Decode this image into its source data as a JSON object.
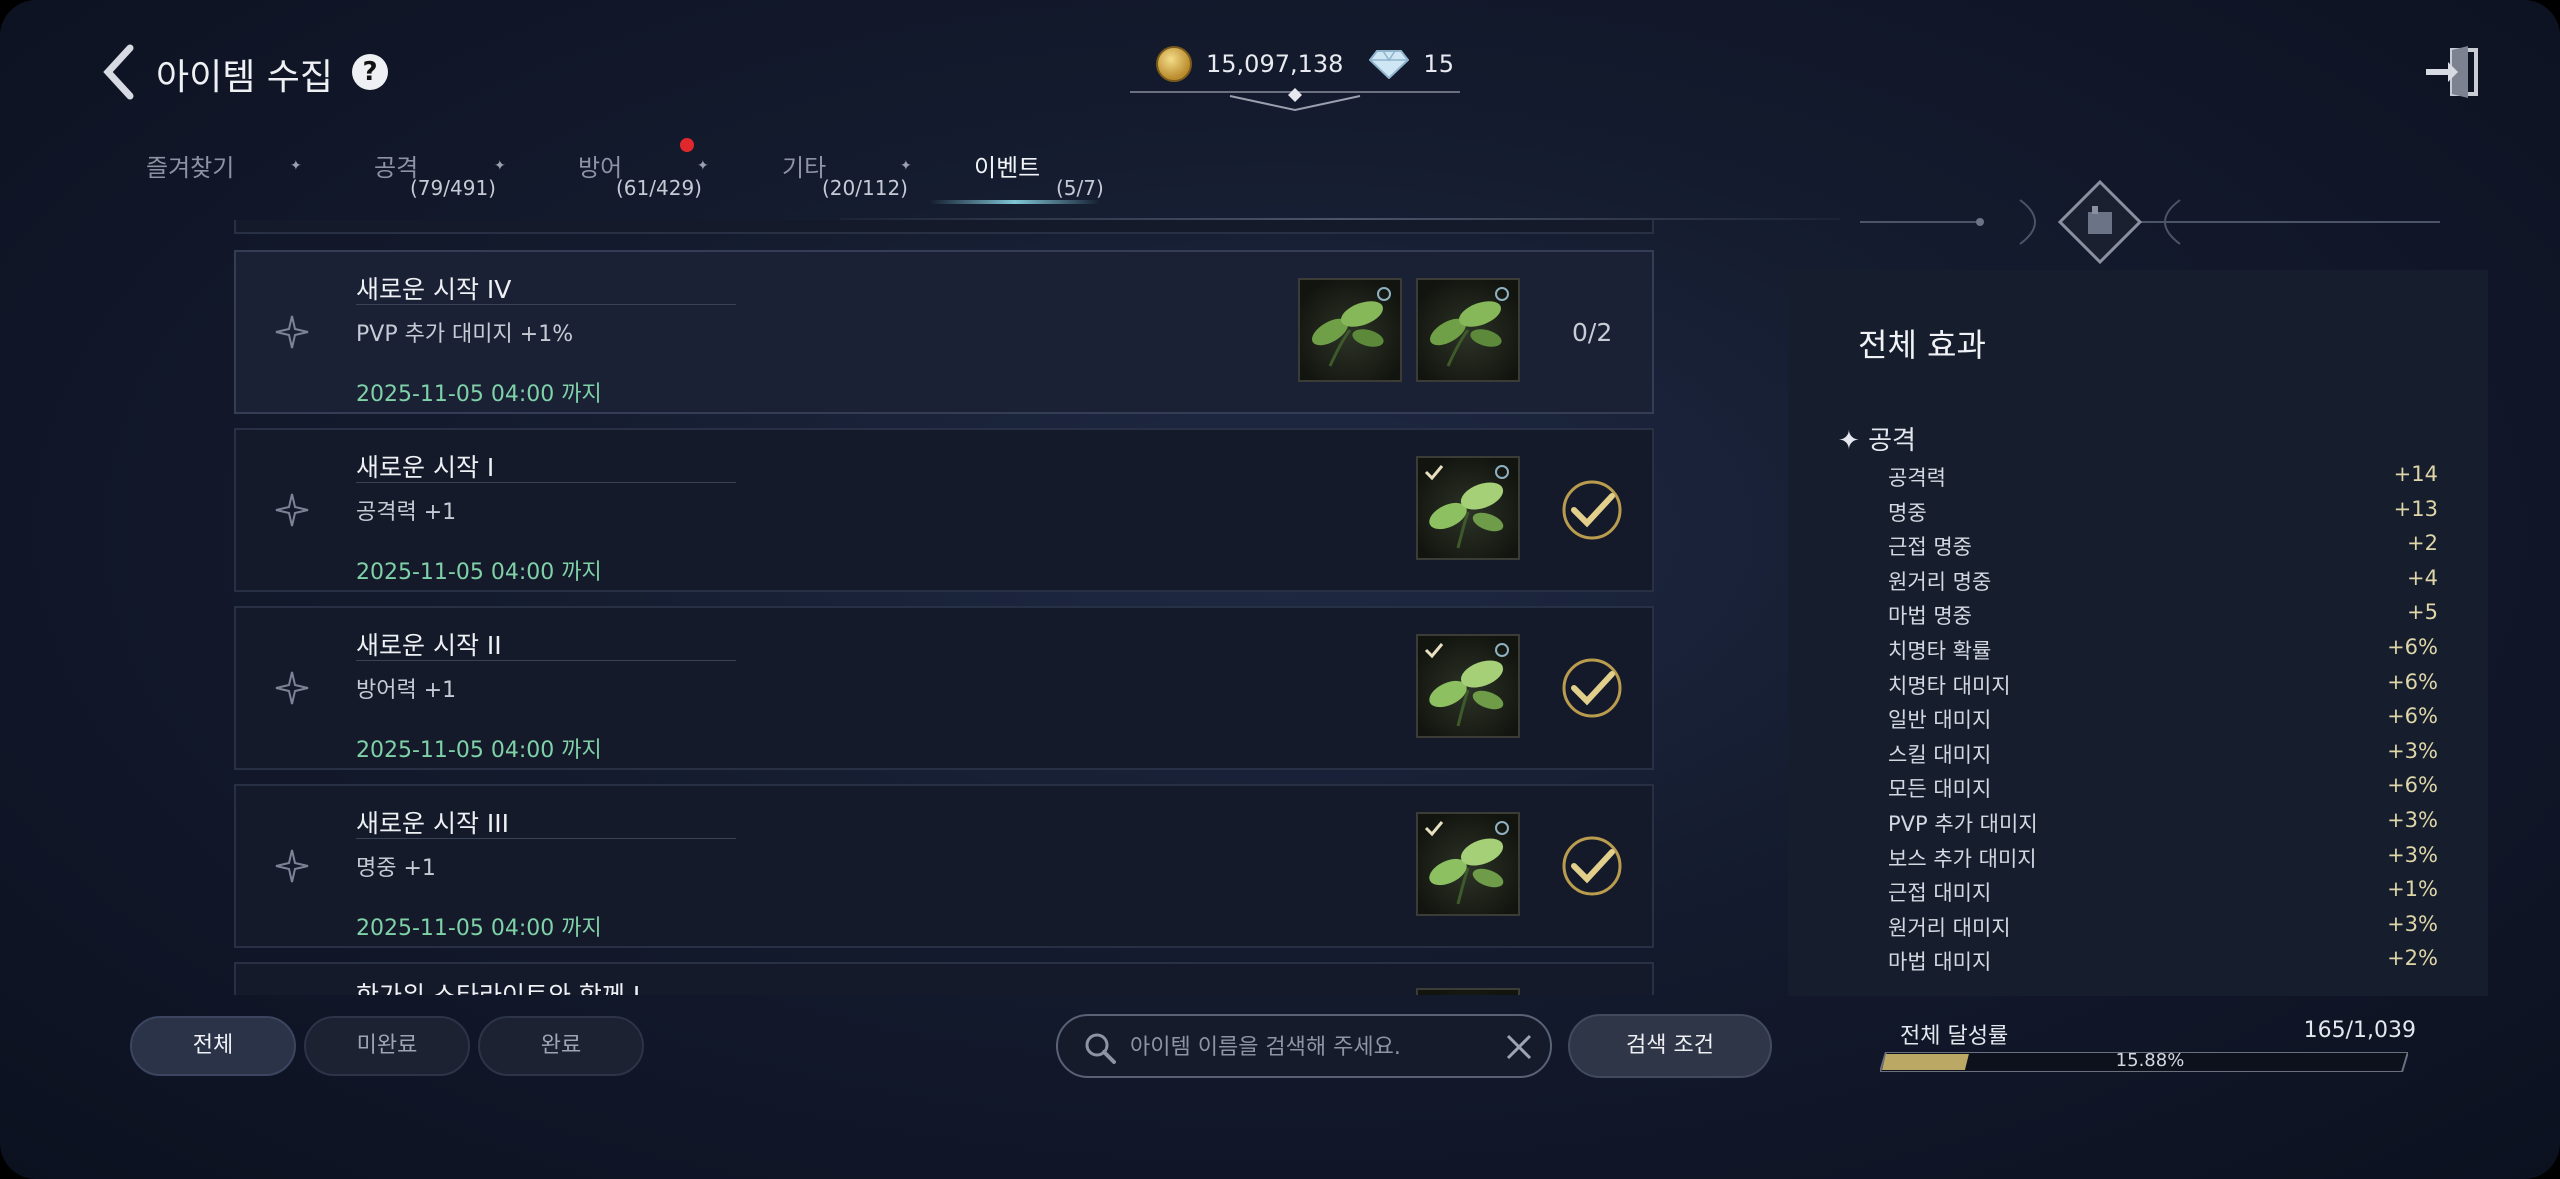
{
  "header": {
    "title": "아이템 수집",
    "help_icon": "?",
    "gold": "15,097,138",
    "diamond": "15"
  },
  "tabs": [
    {
      "label": "즐겨찾기",
      "count": ""
    },
    {
      "label": "공격",
      "count": "(79/491)"
    },
    {
      "label": "방어",
      "count": "(61/429)",
      "has_alert": true
    },
    {
      "label": "기타",
      "count": "(20/112)"
    },
    {
      "label": "이벤트",
      "count": "(5/7)",
      "active": true
    }
  ],
  "collections": [
    {
      "name": "새로운 시작 IV",
      "effect": "PVP 추가 대미지   +1%",
      "date": "2025-11-05 04:00 까지",
      "progress": "0/2",
      "completed": false,
      "slots": 2,
      "slots_registered": 0
    },
    {
      "name": "새로운 시작 I",
      "effect": "공격력   +1",
      "date": "2025-11-05 04:00 까지",
      "completed": true,
      "slots": 1,
      "slots_registered": 1
    },
    {
      "name": "새로운 시작 II",
      "effect": "방어력   +1",
      "date": "2025-11-05 04:00 까지",
      "completed": true,
      "slots": 1,
      "slots_registered": 1
    },
    {
      "name": "새로운 시작 III",
      "effect": "명중   +1",
      "date": "2025-11-05 04:00 까지",
      "completed": true,
      "slots": 1,
      "slots_registered": 1
    },
    {
      "name": "한가위 스타라이트와 함께 I",
      "partial": true
    }
  ],
  "filters": [
    "전체",
    "미완료",
    "완료"
  ],
  "search": {
    "placeholder": "아이템 이름을 검색해 주세요.",
    "condition_button": "검색 조건"
  },
  "total_effects": {
    "title": "전체 효과",
    "category": "공격",
    "rows": [
      {
        "label": "공격력",
        "value": "+14"
      },
      {
        "label": "명중",
        "value": "+13"
      },
      {
        "label": "근접 명중",
        "value": "+2"
      },
      {
        "label": "원거리 명중",
        "value": "+4"
      },
      {
        "label": "마법 명중",
        "value": "+5"
      },
      {
        "label": "치명타 확률",
        "value": "+6%"
      },
      {
        "label": "치명타 대미지",
        "value": "+6%"
      },
      {
        "label": "일반 대미지",
        "value": "+6%"
      },
      {
        "label": "스킬 대미지",
        "value": "+3%"
      },
      {
        "label": "모든 대미지",
        "value": "+6%"
      },
      {
        "label": "PVP 추가 대미지",
        "value": "+3%"
      },
      {
        "label": "보스 추가 대미지",
        "value": "+3%"
      },
      {
        "label": "근접 대미지",
        "value": "+1%"
      },
      {
        "label": "원거리 대미지",
        "value": "+3%"
      },
      {
        "label": "마법 대미지",
        "value": "+2%"
      }
    ]
  },
  "achievement": {
    "label": "전체 달성률",
    "value": "165/1,039",
    "percent": "15.88%",
    "fraction": 0.1588
  },
  "colors": {
    "accent_teal": "#7fc6d6",
    "date_green": "#7fd1a8",
    "gold": "#d8c27a",
    "alert_red": "#e0282c"
  }
}
